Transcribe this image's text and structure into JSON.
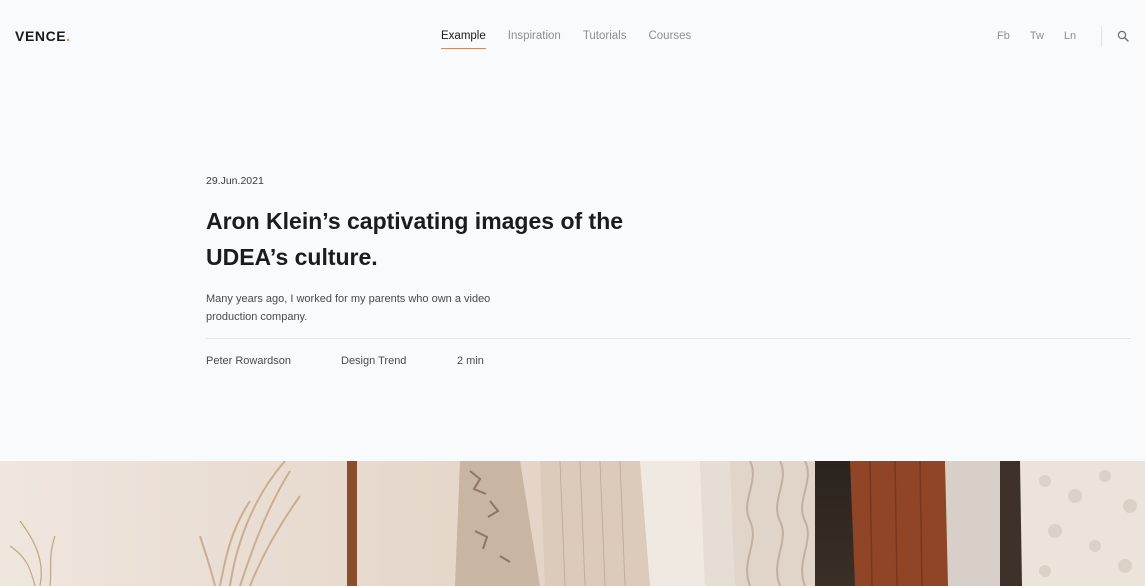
{
  "header": {
    "logo": "VENCE",
    "logo_dot": ".",
    "nav": [
      {
        "label": "Example",
        "active": true
      },
      {
        "label": "Inspiration",
        "active": false
      },
      {
        "label": "Tutorials",
        "active": false
      },
      {
        "label": "Courses",
        "active": false
      }
    ],
    "social": [
      "Fb",
      "Tw",
      "Ln"
    ]
  },
  "article": {
    "date": "29.Jun.2021",
    "title": "Aron Klein’s captivating images of the UDEA’s culture.",
    "description": "Many years ago, I worked for my parents who own a video production company.",
    "author": "Peter Rowardson",
    "category": "Design Trend",
    "read_time": "2 min"
  },
  "colors": {
    "accent": "#d9865f",
    "background": "#f9fafc",
    "text": "#1c1c1c",
    "muted": "#8e8e93"
  }
}
